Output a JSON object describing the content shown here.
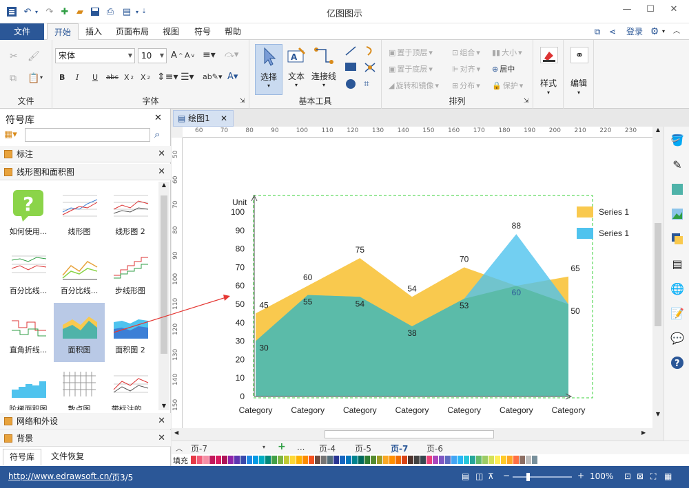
{
  "app": {
    "title": "亿图图示"
  },
  "menu": {
    "file": "文件",
    "tabs": [
      "开始",
      "插入",
      "页面布局",
      "视图",
      "符号",
      "帮助"
    ],
    "login": "登录"
  },
  "ribbon": {
    "font_name": "宋体",
    "font_size": "10",
    "groups": {
      "file": "文件",
      "font": "字体",
      "basic_tools": "基本工具",
      "arrange": "排列",
      "style": "样式",
      "edit": "编辑"
    },
    "tools": {
      "select": "选择",
      "text": "文本",
      "connector": "连接线"
    },
    "arrange": {
      "bring_front": "置于顶层",
      "send_back": "置于底层",
      "rotate": "旋转和镜像",
      "group": "组合",
      "align": "对齐",
      "distribute": "分布",
      "size": "大小",
      "center": "居中",
      "protect": "保护"
    }
  },
  "library": {
    "title": "符号库",
    "search_placeholder": "",
    "sections": {
      "annotation": "标注",
      "line_area": "线形图和面积图",
      "network": "网络和外设",
      "background": "背景"
    },
    "symbols": [
      "如何使用...",
      "线形图",
      "线形图 2",
      "百分比线...",
      "百分比线...",
      "步线形图",
      "直角折线...",
      "面积图",
      "面积图 2",
      "阶梯面积图",
      "散点图",
      "带标注的..."
    ],
    "bottom_tabs": [
      "符号库",
      "文件恢复"
    ]
  },
  "document": {
    "tab": "绘图1"
  },
  "ruler": {
    "h": [
      "60",
      "70",
      "80",
      "90",
      "100",
      "110",
      "120",
      "130",
      "140",
      "150",
      "160",
      "170",
      "180",
      "190",
      "200",
      "210",
      "220",
      "230"
    ],
    "v": [
      "50",
      "60",
      "70",
      "80",
      "90",
      "100",
      "110",
      "120",
      "130",
      "140",
      "150"
    ]
  },
  "pages": {
    "current": "页-7",
    "tabs": [
      "...",
      "页-4",
      "页-5",
      "页-7",
      "页-6"
    ],
    "fill_label": "填充"
  },
  "status": {
    "url": "http://www.edrawsoft.cn/",
    "page": "页3/5",
    "zoom": "100%"
  },
  "chart_data": {
    "type": "area",
    "ylabel": "Unit",
    "ylim": [
      0,
      100
    ],
    "yticks": [
      "0",
      "10",
      "20",
      "30",
      "40",
      "50",
      "60",
      "70",
      "80",
      "90",
      "100"
    ],
    "categories": [
      "Category",
      "Category",
      "Category",
      "Category",
      "Category",
      "Category",
      "Category"
    ],
    "series": [
      {
        "name": "Series 1",
        "color": "#f9c94e",
        "values": [
          45,
          60,
          75,
          54,
          70,
          60,
          65
        ]
      },
      {
        "name": "Series 1",
        "color": "#4fc3ee",
        "values": [
          30,
          55,
          54,
          38,
          53,
          88,
          50
        ]
      }
    ]
  }
}
